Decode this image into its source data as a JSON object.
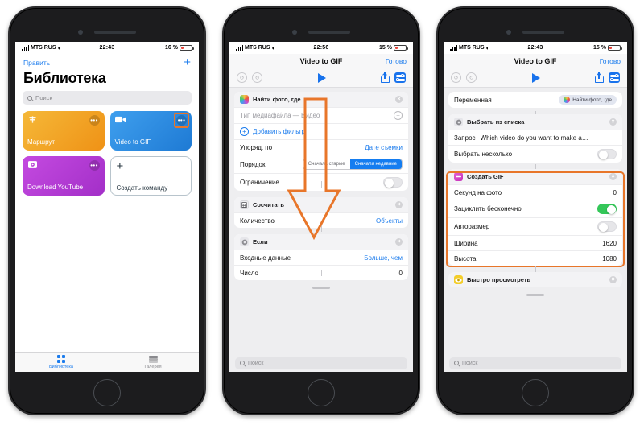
{
  "colors": {
    "highlight": "#e8762a",
    "ios_blue": "#1c7ced",
    "toggle_green": "#34c759",
    "card_orange": "#f0a227",
    "card_blue": "#2b8fe8",
    "card_purple": "#b93fd6"
  },
  "phone1": {
    "statusbar": {
      "carrier": "MTS RUS",
      "time": "22:43",
      "battery": "16 %"
    },
    "nav": {
      "edit_label": "Править",
      "add_label": "+"
    },
    "title": "Библиотека",
    "search": {
      "placeholder": "Поиск"
    },
    "cards": [
      {
        "label": "Маршрут",
        "icon": "signpost-icon",
        "color": "#f0a227",
        "menu": "•••"
      },
      {
        "label": "Video to GIF",
        "icon": "video-camera-icon",
        "color": "#2b8fe8",
        "menu": "•••",
        "highlighted": true
      },
      {
        "label": "Download YouTube",
        "icon": "media-play-icon",
        "color": "#b93fd6",
        "menu": "•••"
      }
    ],
    "new_card": {
      "label": "Создать команду",
      "plus": "+"
    },
    "tabs": [
      {
        "label": "Библиотека",
        "icon": "grid-icon",
        "active": true
      },
      {
        "label": "Галерея",
        "icon": "layers-icon",
        "active": false
      }
    ]
  },
  "phone2": {
    "statusbar": {
      "carrier": "MTS RUS",
      "time": "22:56",
      "battery": "15 %"
    },
    "nav": {
      "title": "Video to GIF",
      "done_label": "Готово"
    },
    "toolbar": {
      "undo": "↺",
      "redo": "↻",
      "run": "play-icon",
      "share": "share-icon",
      "settings": "sliders-icon"
    },
    "blocks": [
      {
        "title": "Найти фото, где",
        "icon": "photos-icon",
        "icon_color": "#e8543f",
        "close": "×",
        "rows": [
          {
            "label": "Тип медиафайла  —  Видео",
            "value": "",
            "type": "filter-minus",
            "muted": true
          },
          {
            "label": "Добавить фильтр",
            "value": "",
            "type": "add-filter"
          },
          {
            "label": "Упоряд. по",
            "value": "Дате съемки",
            "type": "value-blue"
          },
          {
            "label": "Порядок",
            "value": "",
            "type": "segmented",
            "options": [
              "Сначала старые",
              "Сначала недавние"
            ],
            "selected": 1
          },
          {
            "label": "Ограничение",
            "value": "",
            "type": "toggle",
            "on": false
          }
        ]
      },
      {
        "title": "Сосчитать",
        "icon": "calculator-icon",
        "icon_color": "#5c5c62",
        "close": "×",
        "rows": [
          {
            "label": "Количество",
            "value": "Объекты",
            "type": "value-blue"
          }
        ]
      },
      {
        "title": "Если",
        "icon": "gear-icon",
        "icon_color": "#8e8e93",
        "close": "×",
        "rows": [
          {
            "label": "Входные данные",
            "value": "Больше, чем",
            "type": "value-blue"
          },
          {
            "label": "Число",
            "value": "0",
            "type": "value"
          }
        ]
      }
    ],
    "search": {
      "placeholder": "Поиск"
    },
    "annotation": {
      "shape": "down-arrow",
      "color": "#e8762a"
    }
  },
  "phone3": {
    "statusbar": {
      "carrier": "MTS RUS",
      "time": "22:43",
      "battery": "15 %"
    },
    "nav": {
      "title": "Video to GIF",
      "done_label": "Готово"
    },
    "toolbar": {
      "undo": "↺",
      "redo": "↻",
      "run": "play-icon",
      "share": "share-icon",
      "settings": "sliders-icon"
    },
    "blocks": [
      {
        "title": "",
        "icon": "",
        "rows": [
          {
            "label": "Переменная",
            "value": "Найти фото, где",
            "type": "pill",
            "pill_icon": "photos-icon"
          }
        ]
      },
      {
        "title": "Выбрать из списка",
        "icon": "gear-icon",
        "icon_color": "#8e8e93",
        "close": "×",
        "rows": [
          {
            "label": "Запрос",
            "value": "Which video do you want to make a…",
            "type": "text-value"
          },
          {
            "label": "Выбрать несколько",
            "value": "",
            "type": "toggle",
            "on": false
          }
        ]
      },
      {
        "title": "Создать GIF",
        "icon": "gif-icon",
        "icon_color": "#d13fbf",
        "close": "×",
        "highlighted": true,
        "rows": [
          {
            "label": "Секунд на фото",
            "value": "0",
            "type": "value"
          },
          {
            "label": "Зациклить бесконечно",
            "value": "",
            "type": "toggle",
            "on": true
          },
          {
            "label": "Авторазмер",
            "value": "",
            "type": "toggle",
            "on": false
          },
          {
            "label": "Ширина",
            "value": "1620",
            "type": "value"
          },
          {
            "label": "Высота",
            "value": "1080",
            "type": "value"
          }
        ]
      },
      {
        "title": "Быстро просмотреть",
        "icon": "eye-icon",
        "icon_color": "#f0c419",
        "close": "×",
        "rows": []
      }
    ],
    "search": {
      "placeholder": "Поиск"
    }
  }
}
